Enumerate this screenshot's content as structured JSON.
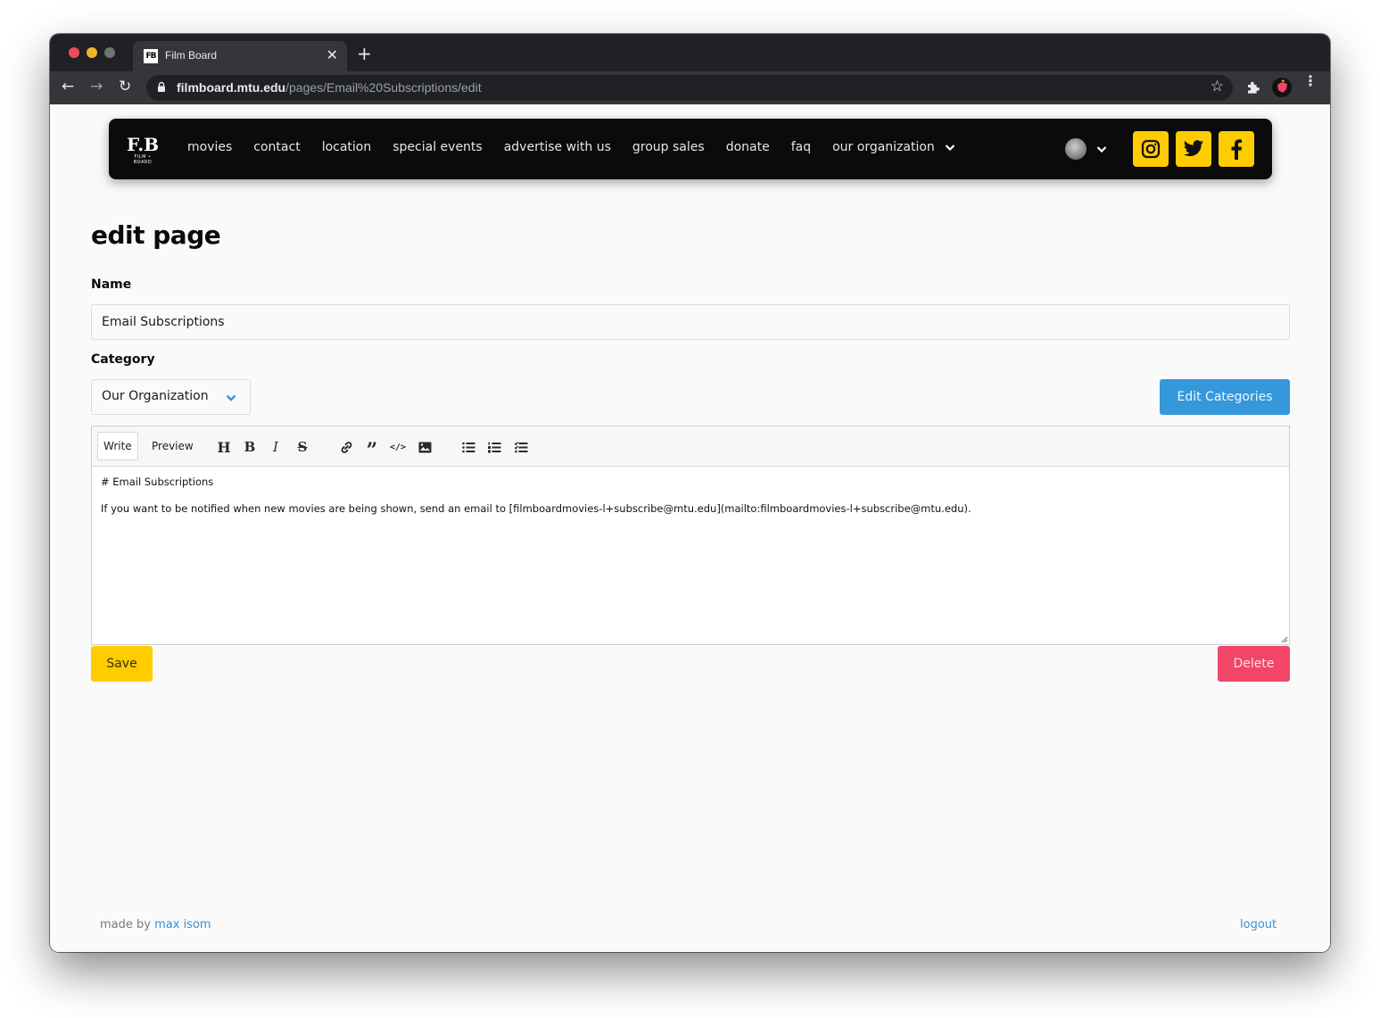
{
  "browser": {
    "tab_title": "Film Board",
    "tab_favicon_text": "FB",
    "url_host": "filmboard.mtu.edu",
    "url_path": "/pages/Email%20Subscriptions/edit",
    "close_glyph": "✕",
    "new_tab_glyph": "+",
    "back_glyph": "←",
    "forward_glyph": "→",
    "reload_glyph": "↻",
    "star_glyph": "☆",
    "menu_glyph": "⋮"
  },
  "site_nav": {
    "logo_text": "F.B",
    "logo_subtext": "FILM • BOARD",
    "links": [
      {
        "label": "movies"
      },
      {
        "label": "contact"
      },
      {
        "label": "location"
      },
      {
        "label": "special events"
      },
      {
        "label": "advertise with us"
      },
      {
        "label": "group sales"
      },
      {
        "label": "donate"
      },
      {
        "label": "faq"
      }
    ],
    "dropdown_label": "our organization",
    "social": [
      "instagram",
      "twitter",
      "facebook"
    ],
    "accent_color": "#ffcc00"
  },
  "main": {
    "page_title": "edit page",
    "name_label": "Name",
    "name_value": "Email Subscriptions",
    "category_label": "Category",
    "category_value": "Our Organization",
    "edit_categories_label": "Edit Categories",
    "editor": {
      "write_tab": "Write",
      "preview_tab": "Preview",
      "tools": [
        "header",
        "bold",
        "italic",
        "strikethrough",
        "link",
        "quote",
        "code",
        "image",
        "unordered-list",
        "ordered-list",
        "checked-list"
      ],
      "lines": [
        "# Email Subscriptions",
        "If you want to be notified when new movies are being shown, send an email to [filmboardmovies-l+subscribe@mtu.edu](mailto:filmboardmovies-l+subscribe@mtu.edu)."
      ]
    },
    "save_label": "Save",
    "delete_label": "Delete"
  },
  "footer": {
    "made_by_prefix": "made by",
    "author": "max isom",
    "logout_label": "logout"
  },
  "colors": {
    "primary_blue": "#3498db",
    "save_yellow": "#ffcc00",
    "danger_red": "#f14668",
    "link_blue": "#3a8fd6"
  }
}
